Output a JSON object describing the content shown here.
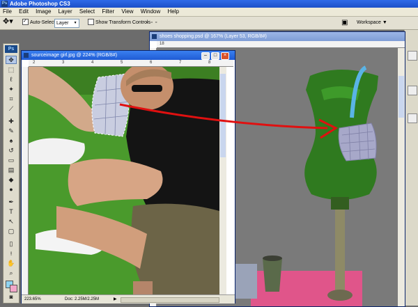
{
  "app": {
    "title": "Adobe Photoshop CS3",
    "logo": "Ps",
    "mini_logo": "Ps"
  },
  "menu": [
    "File",
    "Edit",
    "Image",
    "Layer",
    "Select",
    "Filter",
    "View",
    "Window",
    "Help"
  ],
  "options": {
    "auto_select_label": "Auto-Select:",
    "auto_select_checked": true,
    "auto_select_value": "Layer",
    "show_transform_label": "Show Transform Controls",
    "show_transform_checked": false,
    "workspace_label": "Workspace ▼"
  },
  "doc_back": {
    "title": "shoes shopping.psd @ 167% (Layer 53, RGB/8#)",
    "ruler_ticks": [
      "18",
      "",
      "",
      "",
      "",
      "",
      "",
      "",
      ""
    ]
  },
  "doc_front": {
    "title": "sourceimage girl.jpg @ 224% (RGB/8#)",
    "ruler_ticks": [
      "2",
      "",
      "3",
      "",
      "4",
      "",
      "5",
      "",
      "6",
      "",
      "7",
      "",
      "8",
      "",
      "9"
    ],
    "zoom": "223.65%",
    "doc_size": "Doc: 2.25M/2.25M"
  },
  "colors": {
    "accent_arrow": "#e01010",
    "titlebar": "#2f6ae8",
    "foreground_swatch": "#8fd3f0",
    "background_swatch": "#f2a7c9"
  },
  "icons": {
    "move_tool": "move-tool-icon",
    "marquee": "marquee-icon",
    "lasso": "lasso-icon",
    "magic_wand": "magic-wand-icon",
    "crop": "crop-icon"
  }
}
